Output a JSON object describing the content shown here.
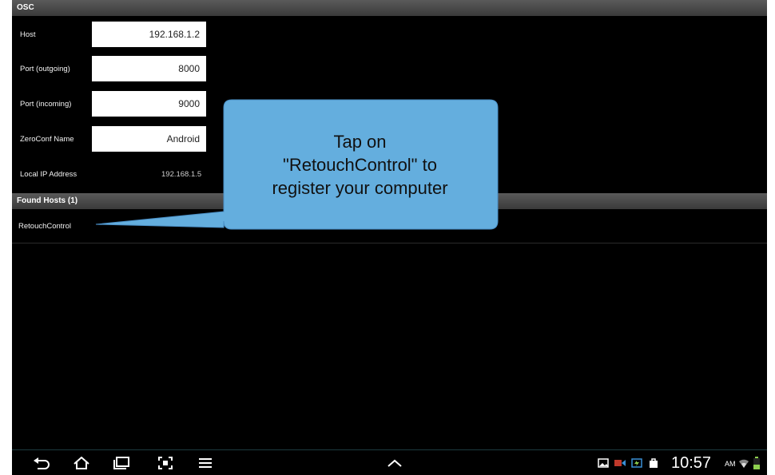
{
  "app": {
    "section_title": "OSC"
  },
  "settings": {
    "host": {
      "label": "Host",
      "value": "192.168.1.2"
    },
    "port_out": {
      "label": "Port (outgoing)",
      "value": "8000"
    },
    "port_in": {
      "label": "Port (incoming)",
      "value": "9000"
    },
    "zeroconf": {
      "label": "ZeroConf Name",
      "value": "Android"
    },
    "local_ip": {
      "label": "Local IP Address",
      "value": "192.168.1.5"
    }
  },
  "found_hosts": {
    "title": "Found Hosts (1)",
    "items": [
      "RetouchControl"
    ]
  },
  "callout": {
    "lines": [
      "Tap on",
      "\"RetouchControl\" to",
      "register your computer"
    ],
    "color": "#64aede"
  },
  "navbar": {
    "icons": [
      "back-icon",
      "home-icon",
      "recent-apps-icon",
      "screenshot-icon",
      "menu-icon",
      "expand-up-icon"
    ],
    "status_icons": [
      "gallery-icon",
      "video-icon",
      "usb-icon",
      "shopping-bag-icon",
      "wifi-icon",
      "battery-icon"
    ],
    "time": "10:57",
    "ampm": "AM"
  }
}
